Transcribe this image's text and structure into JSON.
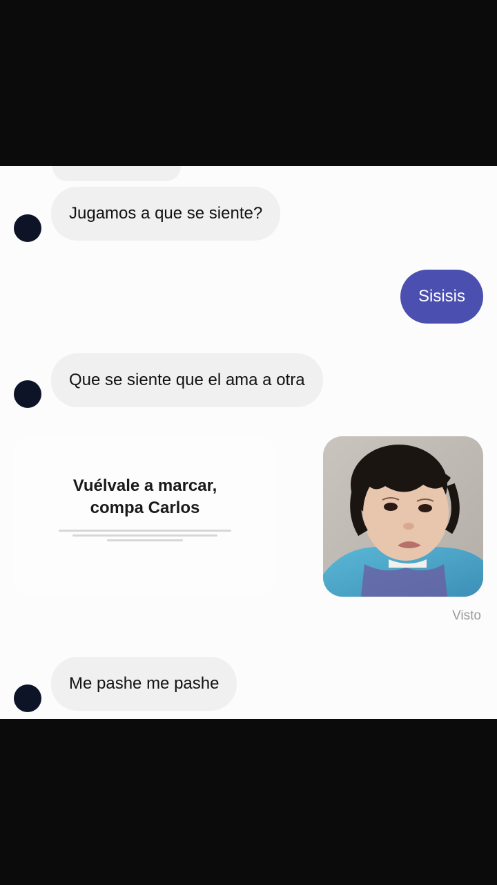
{
  "messages": {
    "m1": "Jugamos a que se siente?",
    "m2": "Sisisis",
    "m3": "Que se siente que el ama a otra",
    "m4_caption_line1": "Vuélvale a marcar,",
    "m4_caption_line2": "compa Carlos",
    "m5": "Me pashe me pashe"
  },
  "status": {
    "seen_label": "Visto"
  },
  "colors": {
    "outgoing_bubble": "#4b4fb0",
    "incoming_bubble": "#f0f0f0",
    "avatar": "#0e1428"
  }
}
